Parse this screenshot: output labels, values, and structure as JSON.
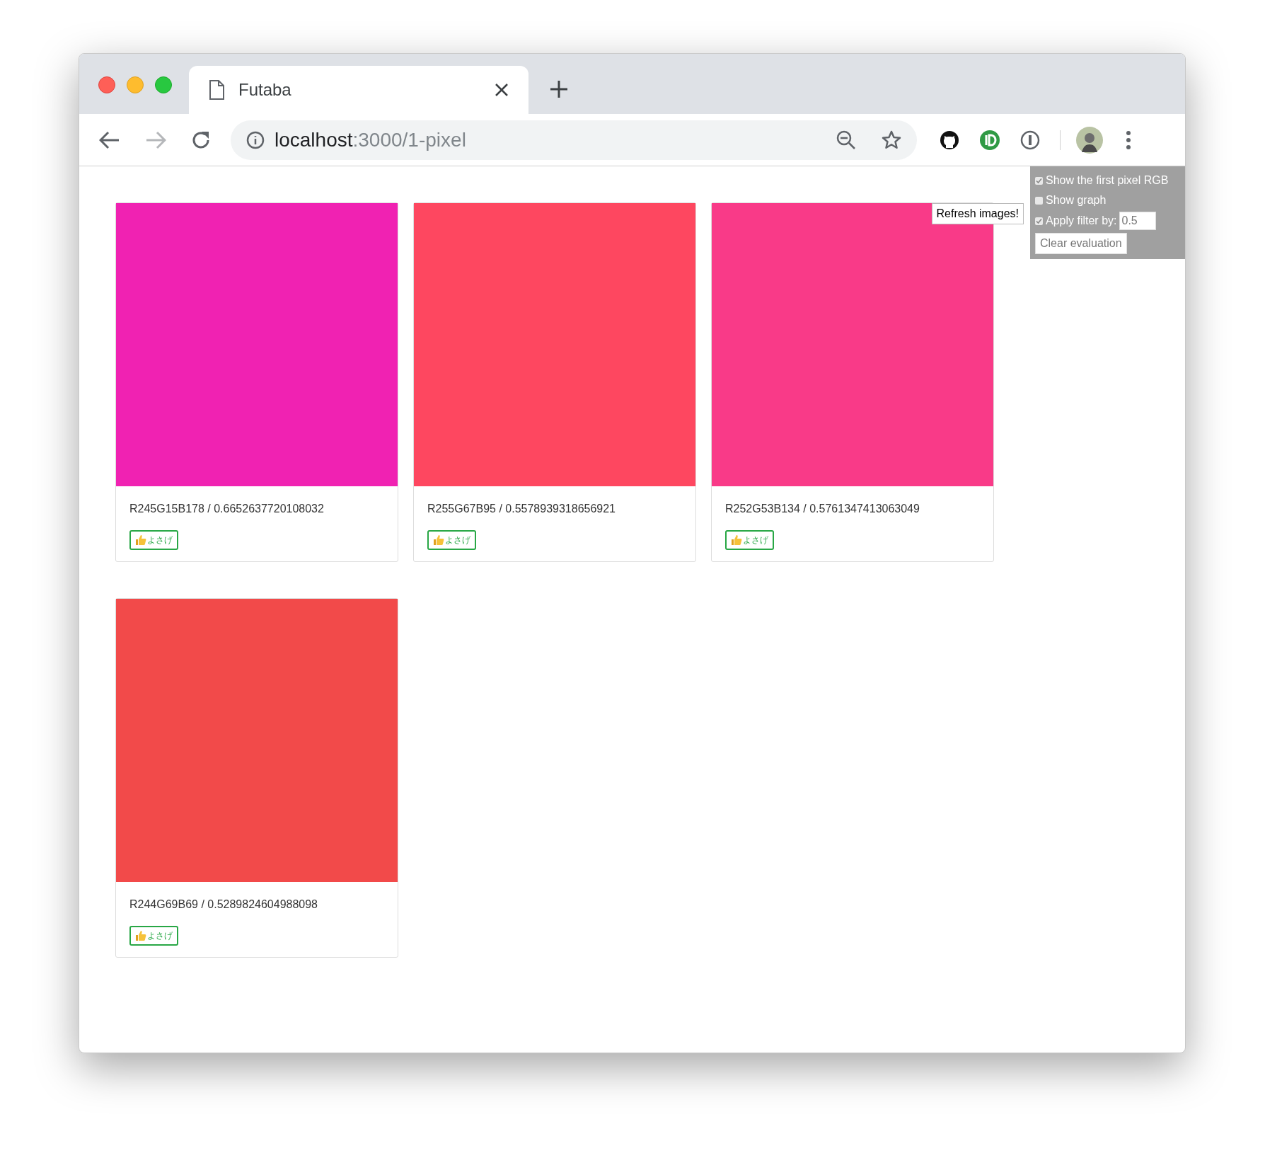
{
  "browser": {
    "tab_title": "Futaba",
    "url_host": "localhost",
    "url_path": ":3000/1-pixel"
  },
  "cards": [
    {
      "color": "#f022b2",
      "caption": "R245G15B178 / 0.6652637720108032",
      "button": "よさげ"
    },
    {
      "color": "#fe4760",
      "caption": "R255G67B95 / 0.5578939318656921",
      "button": "よさげ"
    },
    {
      "color": "#f93a88",
      "caption": "R252G53B134 / 0.5761347413063049",
      "button": "よさげ"
    },
    {
      "color": "#f24a4a",
      "caption": "R244G69B69 / 0.5289824604988098",
      "button": "よさげ"
    }
  ],
  "controls": {
    "refresh_button": "Refresh images!",
    "options": [
      {
        "label": "Show the first pixel RGB",
        "checked": true
      },
      {
        "label": "Show graph",
        "checked": false
      },
      {
        "label": "Apply filter by:",
        "checked": true
      }
    ],
    "filter_value": "0.5",
    "clear_button": "Clear evaluation"
  }
}
